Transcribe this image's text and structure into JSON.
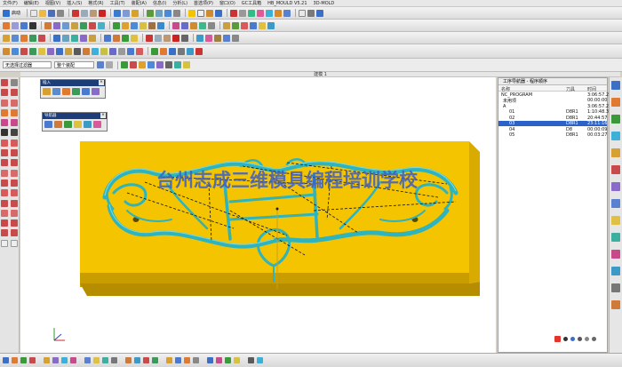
{
  "menu": [
    "文件(F)",
    "编辑(E)",
    "视图(V)",
    "插入(S)",
    "格式(R)",
    "工具(T)",
    "装配(A)",
    "信息(I)",
    "分析(L)",
    "首选项(P)",
    "窗口(O)",
    "GC工具箱",
    "HB_MOULD V5.21",
    "3D-MOLD"
  ],
  "toolbar": {
    "start_label": "启动",
    "filter_label": "无选择过滤器",
    "assembly_label": "整个装配"
  },
  "graphics": {
    "title": "建模 1",
    "watermark": "台州志成三维模具编程培训学校"
  },
  "palettes": {
    "insert": "插入",
    "navigator": "导航器"
  },
  "navigator": {
    "title": "工序导航器 - 程序顺序",
    "columns": {
      "name": "名称",
      "tool": "刀具",
      "time": "时间"
    },
    "rows": [
      {
        "name": "NC_PROGRAM",
        "tool": "",
        "time": "3:06:57.2",
        "selected": false
      },
      {
        "name": "未用项",
        "tool": "",
        "time": "00:00:00",
        "selected": false
      },
      {
        "name": "A",
        "tool": "",
        "time": "3:06:57.2",
        "selected": false
      },
      {
        "name": "01",
        "tool": "D8R1",
        "time": "1:10:48.3",
        "selected": false
      },
      {
        "name": "02",
        "tool": "D8R1",
        "time": "20:44:57",
        "selected": false
      },
      {
        "name": "03",
        "tool": "D8R1",
        "time": "23:11:16",
        "selected": true
      },
      {
        "name": "04",
        "tool": "D8",
        "time": "00:00:09",
        "selected": false
      },
      {
        "name": "05",
        "tool": "D8R1",
        "time": "00:03:27",
        "selected": false
      }
    ]
  },
  "colors": {
    "part_yellow": "#f5c400",
    "part_dark": "#c99c00",
    "relief_cyan": "#3fc6cf",
    "selection_blue": "#2a62c9",
    "palette_header": "#1c3d7a",
    "watermark_blue": "#3a5ec8"
  }
}
